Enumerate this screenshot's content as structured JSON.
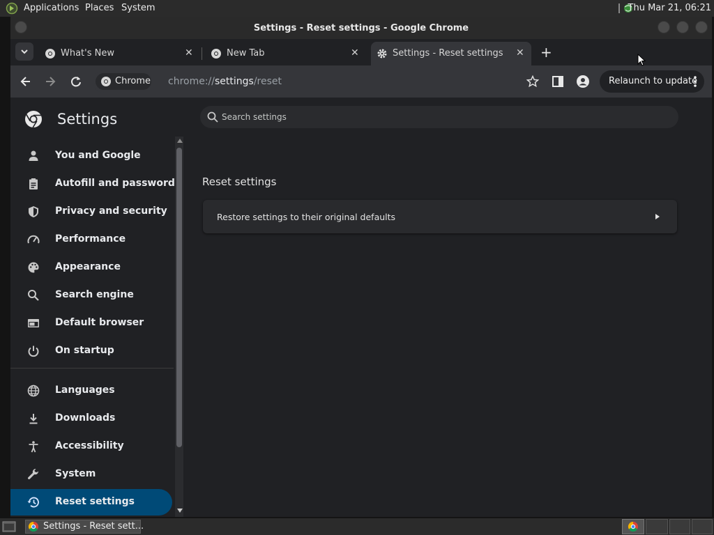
{
  "top_panel": {
    "menus": [
      "Applications",
      "Places",
      "System"
    ],
    "clock": "Thu Mar 21, 06:21"
  },
  "window": {
    "title": "Settings - Reset settings - Google Chrome"
  },
  "tabs": [
    {
      "label": "What's New",
      "icon": "chrome-icon",
      "active": false
    },
    {
      "label": "New Tab",
      "icon": "chrome-icon",
      "active": false
    },
    {
      "label": "Settings - Reset settings",
      "icon": "gear-icon",
      "active": true
    }
  ],
  "toolbar": {
    "site_chip": "Chrome",
    "url_scheme": "chrome://",
    "url_host": "settings",
    "url_path": "/reset",
    "relaunch_label": "Relaunch to update"
  },
  "settings": {
    "title": "Settings",
    "search_placeholder": "Search settings",
    "nav_items": [
      {
        "label": "You and Google",
        "icon": "person-icon"
      },
      {
        "label": "Autofill and passwords",
        "icon": "clipboard-icon"
      },
      {
        "label": "Privacy and security",
        "icon": "shield-icon"
      },
      {
        "label": "Performance",
        "icon": "speedometer-icon"
      },
      {
        "label": "Appearance",
        "icon": "palette-icon"
      },
      {
        "label": "Search engine",
        "icon": "search-icon"
      },
      {
        "label": "Default browser",
        "icon": "browser-icon"
      },
      {
        "label": "On startup",
        "icon": "power-icon"
      },
      {
        "label": "Languages",
        "icon": "globe-icon"
      },
      {
        "label": "Downloads",
        "icon": "download-icon"
      },
      {
        "label": "Accessibility",
        "icon": "accessibility-icon"
      },
      {
        "label": "System",
        "icon": "wrench-icon"
      },
      {
        "label": "Reset settings",
        "icon": "history-icon",
        "active": true
      }
    ],
    "section_title": "Reset settings",
    "restore_label": "Restore settings to their original defaults"
  },
  "taskbar": {
    "task_label": "Settings - Reset sett..."
  },
  "colors": {
    "accent": "#004a77",
    "background": "#202124",
    "toolbar": "#35363a"
  }
}
